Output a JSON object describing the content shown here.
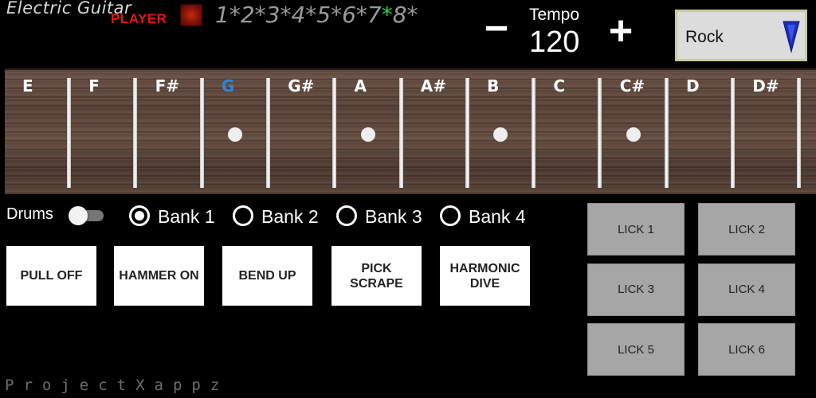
{
  "header": {
    "logo_top": "Electric Guitar",
    "logo_bottom": "PLAYER",
    "sequence_before": "1*2*3*4*5*6*7",
    "sequence_highlight": "*",
    "sequence_after": "8*",
    "highlight_color": "#27d43a"
  },
  "tempo": {
    "label": "Tempo",
    "value": "120",
    "minus_label": "−",
    "plus_label": "+"
  },
  "style_select": {
    "value": "Rock",
    "arrow_color": "#1a2db8"
  },
  "fretboard": {
    "notes": [
      {
        "label": "E",
        "active": false,
        "dot": false
      },
      {
        "label": "F",
        "active": false,
        "dot": false
      },
      {
        "label": "F#",
        "active": false,
        "dot": false
      },
      {
        "label": "G",
        "active": true,
        "dot": true
      },
      {
        "label": "G#",
        "active": false,
        "dot": false
      },
      {
        "label": "A",
        "active": false,
        "dot": true
      },
      {
        "label": "A#",
        "active": false,
        "dot": false
      },
      {
        "label": "B",
        "active": false,
        "dot": true
      },
      {
        "label": "C",
        "active": false,
        "dot": false
      },
      {
        "label": "C#",
        "active": false,
        "dot": true
      },
      {
        "label": "D",
        "active": false,
        "dot": false
      },
      {
        "label": "D#",
        "active": false,
        "dot": false
      }
    ],
    "active_color": "#2f86d8"
  },
  "drums": {
    "label": "Drums",
    "enabled": false
  },
  "banks": [
    {
      "label": "Bank 1",
      "selected": true
    },
    {
      "label": "Bank 2",
      "selected": false
    },
    {
      "label": "Bank 3",
      "selected": false
    },
    {
      "label": "Bank 4",
      "selected": false
    }
  ],
  "techniques": [
    {
      "label": "PULL OFF"
    },
    {
      "label": "HAMMER ON"
    },
    {
      "label": "BEND UP"
    },
    {
      "label": "PICK SCRAPE"
    },
    {
      "label": "HARMONIC DIVE"
    }
  ],
  "licks": [
    {
      "label": "LICK 1"
    },
    {
      "label": "LICK 2"
    },
    {
      "label": "LICK 3"
    },
    {
      "label": "LICK 4"
    },
    {
      "label": "LICK 5"
    },
    {
      "label": "LICK 6"
    }
  ],
  "footer": {
    "text": "ProjectXappz"
  }
}
